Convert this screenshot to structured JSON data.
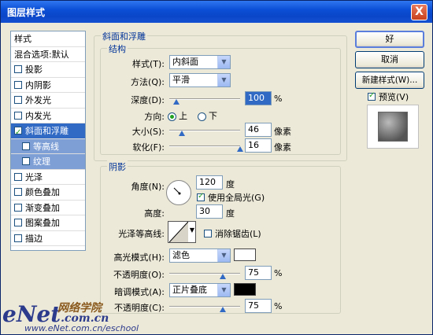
{
  "window": {
    "title": "图层样式",
    "close": "X"
  },
  "sidebar": {
    "items": [
      {
        "label": "样式",
        "type": "head"
      },
      {
        "label": "混合选项:默认",
        "type": "head"
      },
      {
        "label": "投影",
        "checked": false
      },
      {
        "label": "内阴影",
        "checked": false
      },
      {
        "label": "外发光",
        "checked": false
      },
      {
        "label": "内发光",
        "checked": false
      },
      {
        "label": "斜面和浮雕",
        "checked": true,
        "selected": true
      },
      {
        "label": "等高线",
        "checked": false,
        "sub": true
      },
      {
        "label": "纹理",
        "checked": false,
        "sub": true
      },
      {
        "label": "光泽",
        "checked": false
      },
      {
        "label": "颜色叠加",
        "checked": false
      },
      {
        "label": "渐变叠加",
        "checked": false
      },
      {
        "label": "图案叠加",
        "checked": false
      },
      {
        "label": "描边",
        "checked": false
      }
    ]
  },
  "bevel": {
    "group_title": "斜面和浮雕",
    "structure_title": "结构",
    "style_label": "样式(T):",
    "style_value": "内斜面",
    "technique_label": "方法(Q):",
    "technique_value": "平滑",
    "depth_label": "深度(D):",
    "depth_value": "100",
    "depth_unit": "%",
    "depth_fraction": 0.1,
    "direction_label": "方向:",
    "dir_up": "上",
    "dir_down": "下",
    "size_label": "大小(S):",
    "size_value": "46",
    "size_unit": "像素",
    "size_fraction": 0.18,
    "soften_label": "软化(F):",
    "soften_value": "16",
    "soften_unit": "像素",
    "soften_fraction": 1.0
  },
  "shading": {
    "group_title": "阴影",
    "angle_label": "角度(N):",
    "angle_value": "120",
    "angle_unit": "度",
    "global_light": "使用全局光(G)",
    "altitude_label": "高度:",
    "altitude_value": "30",
    "altitude_unit": "度",
    "gloss_label": "光泽等高线:",
    "antialias": "消除锯齿(L)",
    "highlight_label": "高光模式(H):",
    "highlight_value": "滤色",
    "highlight_color": "#ffffff",
    "hl_opacity_label": "不透明度(O):",
    "hl_opacity_value": "75",
    "hl_opacity_unit": "%",
    "hl_fraction": 0.75,
    "shadow_label": "暗调模式(A):",
    "shadow_value": "正片叠底",
    "shadow_color": "#000000",
    "sh_opacity_label": "不透明度(C):",
    "sh_opacity_value": "75",
    "sh_opacity_unit": "%",
    "sh_fraction": 0.75
  },
  "buttons": {
    "ok": "好",
    "cancel": "取消",
    "new_style": "新建样式(W)...",
    "preview": "预览(V)"
  },
  "watermark": {
    "brand": "eNet",
    "domain": ".com.cn",
    "site": "网络学院",
    "url": "www.eNet.com.cn/eschool"
  }
}
